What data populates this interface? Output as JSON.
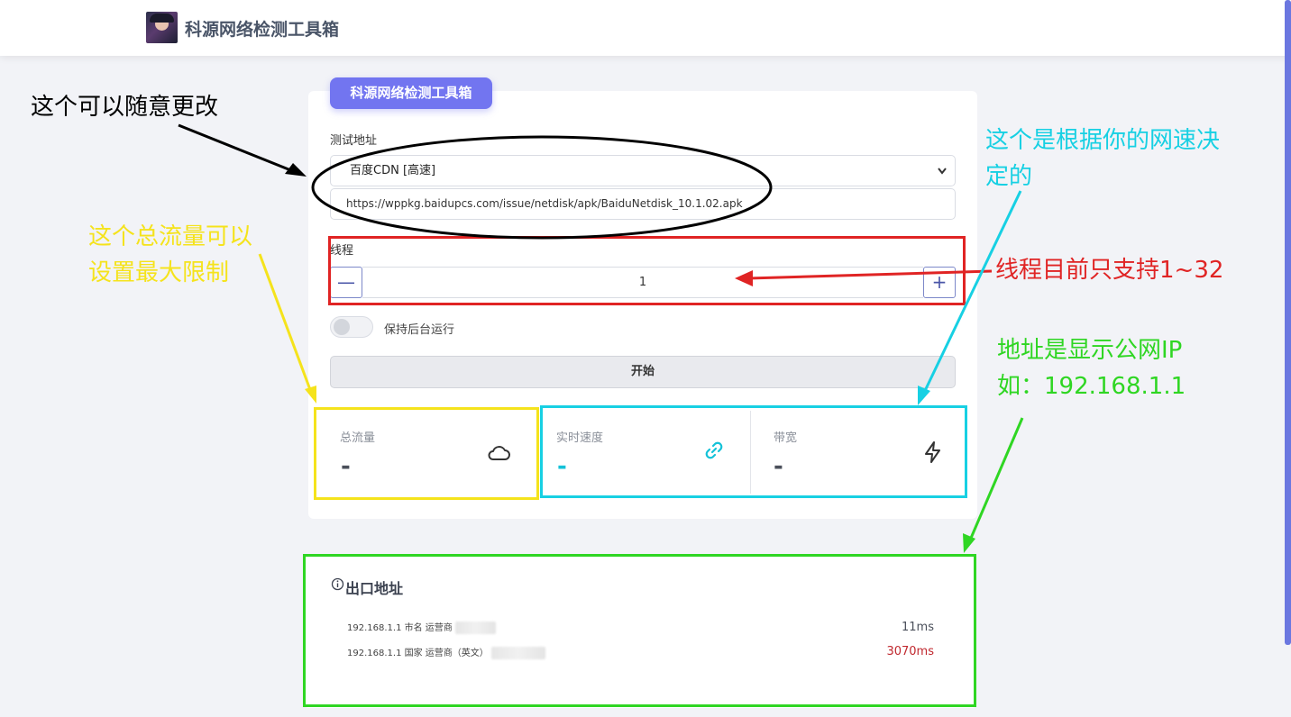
{
  "header": {
    "site_title": "科源网络检测工具箱",
    "logo_icon": "avatar-logo-icon"
  },
  "panel": {
    "tab_label": "科源网络检测工具箱",
    "address_label": "测试地址",
    "address_select": "百度CDN [高速]",
    "address_url": "https://wppkg.baidupcs.com/issue/netdisk/apk/BaiduNetdisk_10.1.02.apk",
    "threads_label": "线程",
    "threads_value": "1",
    "minus_symbol": "—",
    "plus_symbol": "+",
    "background_toggle_label": "保持后台运行",
    "background_toggle_on": false,
    "start_button": "开始"
  },
  "stats": [
    {
      "label": "总流量",
      "value": "-",
      "icon": "cloud-icon"
    },
    {
      "label": "实时速度",
      "value": "-",
      "icon": "link-icon"
    },
    {
      "label": "带宽",
      "value": "-",
      "icon": "lightning-icon"
    }
  ],
  "exit": {
    "title": "出口地址",
    "rows": [
      {
        "ip_text": "192.168.1.1  市名  运营商",
        "ping": "11ms",
        "ping_color": "#4a4f5a"
      },
      {
        "ip_text": "192.168.1.1  国家  运营商（英文）",
        "ping": "3070ms",
        "ping_color": "#c0282e"
      }
    ]
  },
  "annotations": {
    "edit_note": "这个可以随意更改",
    "traffic_note_line1": "这个总流量可以",
    "traffic_note_line2": "设置最大限制",
    "speed_note_line1": "这个是根据你的网速决",
    "speed_note_line2": "定的",
    "threads_note": "线程目前只支持1~32",
    "ip_note_line1": "地址是显示公网IP",
    "ip_note_line2": "如：192.168.1.1",
    "colors": {
      "black": "#000000",
      "yellow": "#f5e31c",
      "cyan": "#17d0e3",
      "red": "#e02424",
      "green": "#2fd623",
      "accent": "#7275f0"
    }
  }
}
